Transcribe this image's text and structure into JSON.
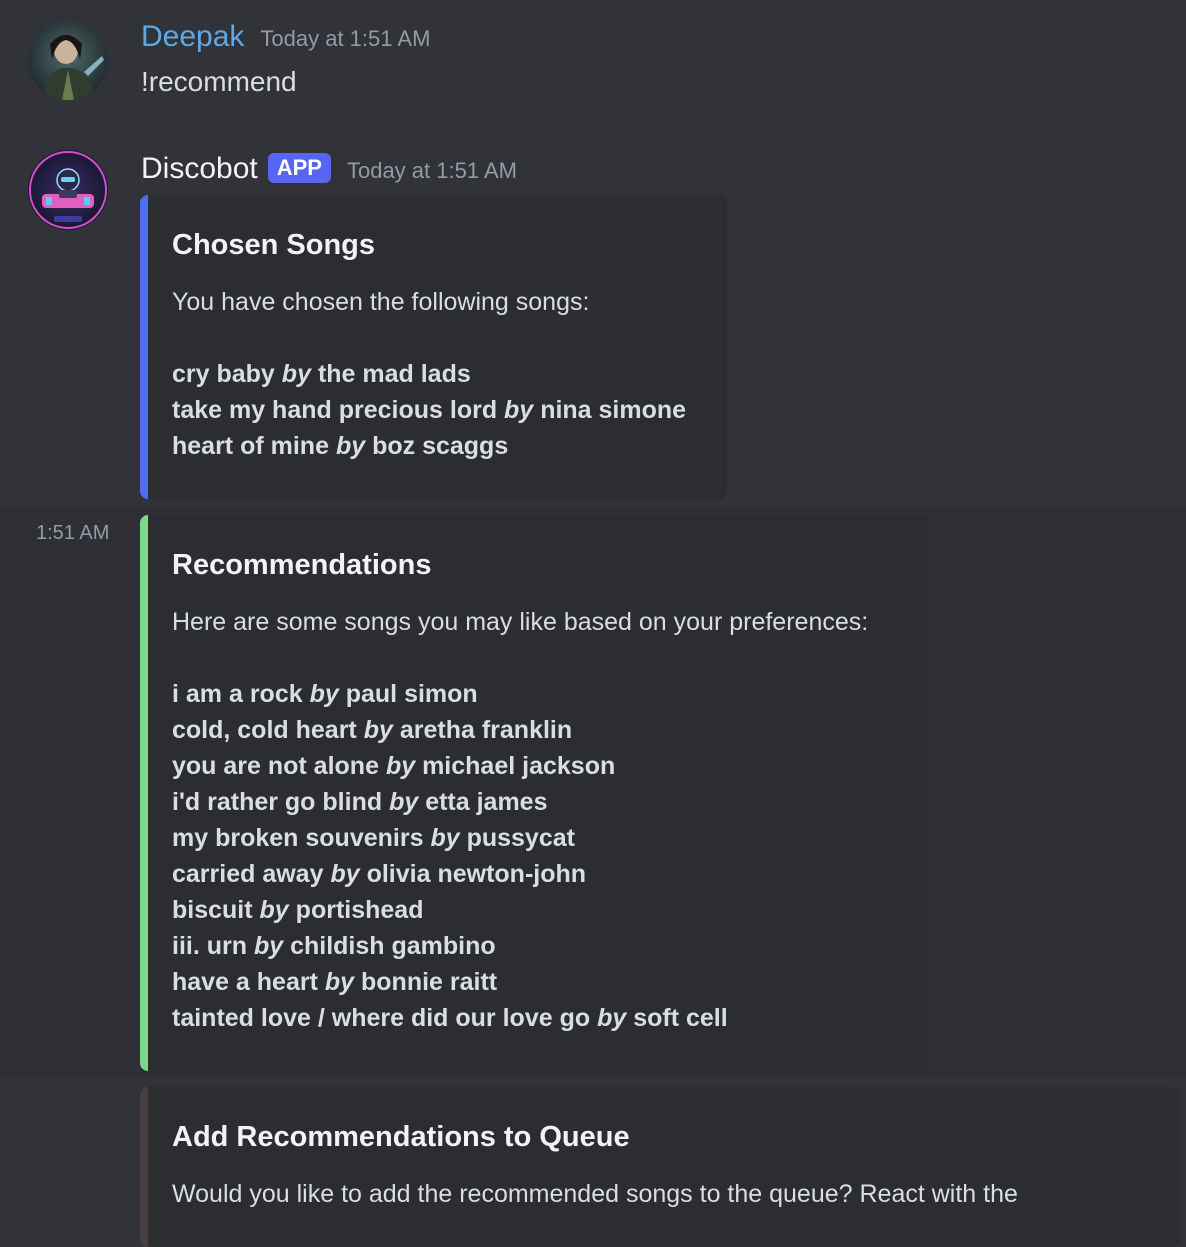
{
  "messages": {
    "user_message": {
      "username": "Deepak",
      "username_color": "#5fa8e8",
      "timestamp": "Today at 1:51 AM",
      "text": "!recommend",
      "avatar_icon": "user-avatar"
    },
    "bot_message": {
      "username": "Discobot",
      "tag": "APP",
      "timestamp": "Today at 1:51 AM",
      "avatar_icon": "bot-avatar",
      "embed_chosen": {
        "title": "Chosen Songs",
        "description": "You have chosen the following songs:",
        "accent_color": "#4e6ef2",
        "songs": [
          {
            "title": "cry baby",
            "by": "by",
            "artist": "the mad lads"
          },
          {
            "title": "take my hand precious lord",
            "by": "by",
            "artist": "nina simone"
          },
          {
            "title": "heart of mine",
            "by": "by",
            "artist": "boz scaggs"
          }
        ]
      }
    },
    "followup_1": {
      "side_timestamp": "1:51 AM",
      "embed": {
        "title": "Recommendations",
        "description": "Here are some songs you may like based on your preferences:",
        "accent_color": "#7ed88a",
        "songs": [
          {
            "title": "i am a rock",
            "by": "by",
            "artist": "paul simon"
          },
          {
            "title": "cold, cold heart",
            "by": "by",
            "artist": "aretha franklin"
          },
          {
            "title": "you are not alone",
            "by": "by",
            "artist": "michael jackson"
          },
          {
            "title": "i'd rather go blind",
            "by": "by",
            "artist": "etta james"
          },
          {
            "title": "my broken souvenirs",
            "by": "by",
            "artist": "pussycat"
          },
          {
            "title": "carried away",
            "by": "by",
            "artist": "olivia newton-john"
          },
          {
            "title": "biscuit",
            "by": "by",
            "artist": "portishead"
          },
          {
            "title": "iii. urn",
            "by": "by",
            "artist": "childish gambino"
          },
          {
            "title": "have a heart",
            "by": "by",
            "artist": "bonnie raitt"
          },
          {
            "title": "tainted love / where did our love go",
            "by": "by",
            "artist": "soft cell"
          }
        ]
      }
    },
    "followup_2": {
      "embed": {
        "title": "Add Recommendations to Queue",
        "description": "Would you like to add the recommended songs to the queue? React with the",
        "accent_color": "#4a3f3f"
      }
    }
  }
}
